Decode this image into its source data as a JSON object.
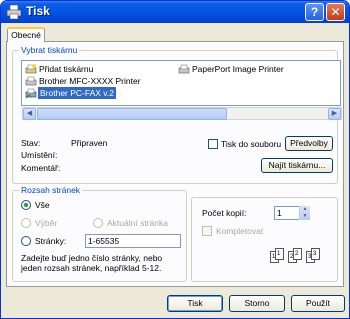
{
  "window": {
    "title": "Tisk",
    "help_label": "?",
    "close_label": "✕"
  },
  "tabs": [
    {
      "label": "Obecné"
    }
  ],
  "printer_group": {
    "legend": "Vybrat tiskárnu",
    "printers": [
      {
        "label": "Přidat tiskárnu",
        "icon": "add-printer-icon"
      },
      {
        "label": "Brother MFC-XXXX   Printer",
        "icon": "printer-icon"
      },
      {
        "label": "Brother PC-FAX v.2",
        "icon": "fax-printer-icon",
        "selected": true
      },
      {
        "label": "PaperPort Image Printer",
        "icon": "printer-icon"
      }
    ],
    "status_label": "Stav:",
    "status_value": "Připraven",
    "location_label": "Umístění:",
    "location_value": "",
    "comment_label": "Komentář:",
    "comment_value": "",
    "print_to_file_label": "Tisk do souboru",
    "preferences_label": "Předvolby",
    "find_printer_label": "Najít tiskárnu..."
  },
  "range_group": {
    "legend": "Rozsah stránek",
    "all_label": "Vše",
    "selection_label": "Výběr",
    "current_page_label": "Aktuální stránka",
    "pages_label": "Stránky:",
    "pages_value": "1-65535",
    "hint": "Zadejte buď jedno číslo stránky, nebo jeden rozsah stránek, například 5-12."
  },
  "copies_group": {
    "copies_label": "Počet kopií:",
    "copies_value": "1",
    "collate_label": "Kompletovat",
    "collate_icon_pages": [
      "1",
      "1",
      "2",
      "2",
      "3",
      "3"
    ]
  },
  "buttons": {
    "print": "Tisk",
    "cancel": "Storno",
    "apply": "Použít"
  }
}
